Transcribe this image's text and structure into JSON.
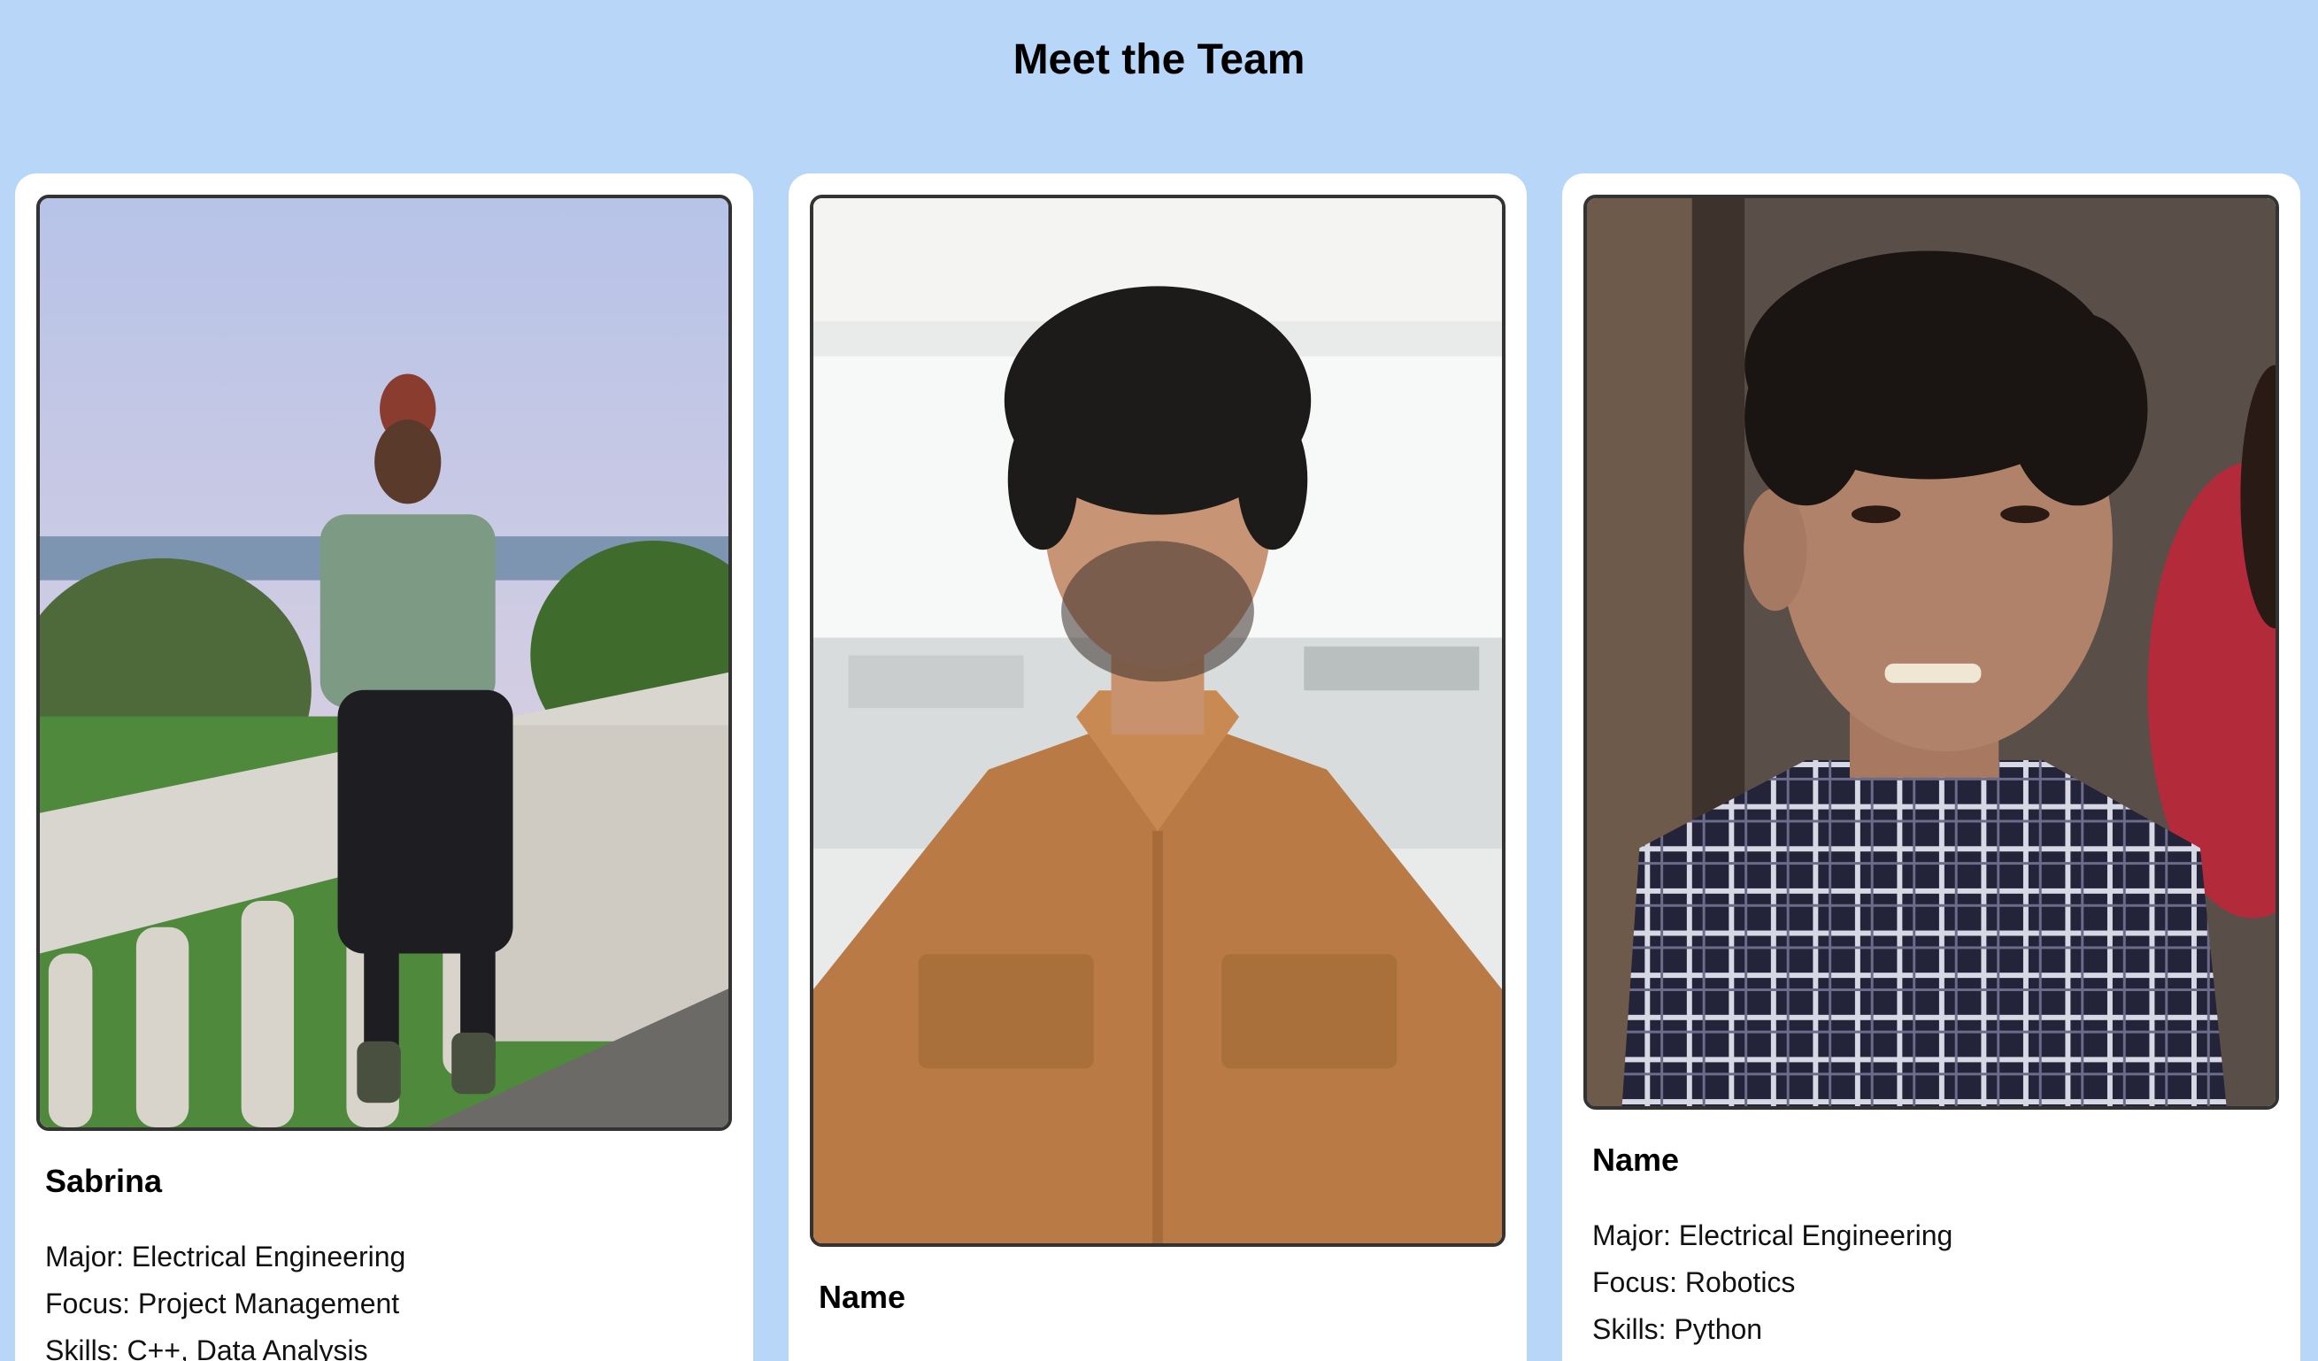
{
  "page": {
    "title": "Meet the Team"
  },
  "members": [
    {
      "name": "Sabrina",
      "major": "Major: Electrical Engineering",
      "focus": "Focus: Project Management",
      "skills": "Skills: C++, Data Analysis"
    },
    {
      "name": "Name"
    },
    {
      "name": "Name",
      "major": "Major: Electrical Engineering",
      "focus": "Focus: Robotics",
      "skills": "Skills: Python"
    }
  ]
}
